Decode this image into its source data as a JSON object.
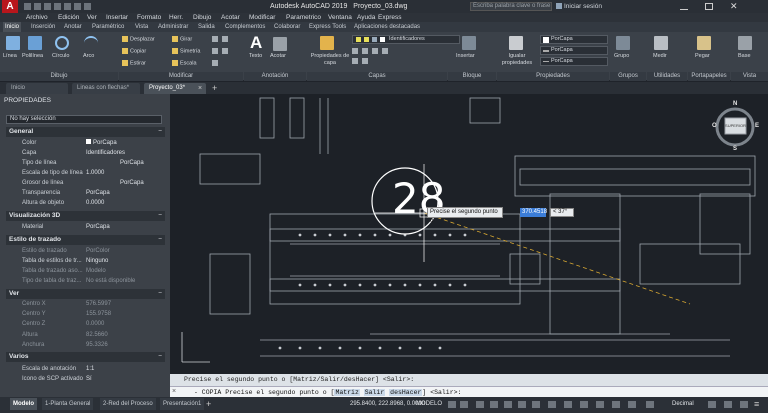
{
  "title_bar": {
    "app_title": "Autodesk AutoCAD 2019",
    "document": "Proyecto_03.dwg",
    "search_placeholder": "Escriba palabra clave o frase",
    "signin": "Iniciar sesión"
  },
  "menu": [
    "Archivo",
    "Edición",
    "Ver",
    "Insertar",
    "Formato",
    "Herr.",
    "Dibujo",
    "Acotar",
    "Modificar",
    "Parametrico",
    "Ventana",
    "Ayuda",
    "Express"
  ],
  "ribbon_tabs": [
    "Inicio",
    "Inserción",
    "Anotar",
    "Paramétrico",
    "Vista",
    "Administrar",
    "Salida",
    "Complementos",
    "Colaborar",
    "Express Tools",
    "Aplicaciones destacadas"
  ],
  "ribbon": {
    "draw": {
      "tools": [
        "Línea",
        "Polilínea",
        "Círculo",
        "Arco"
      ],
      "panel": "Dibujo"
    },
    "modify": {
      "tools": [
        "Desplazar",
        "Girar",
        "Copiar",
        "Simetría",
        "Estirar",
        "Escala"
      ],
      "panel": "Modificar"
    },
    "annotation": {
      "tools": [
        "Texto",
        "Acotar"
      ],
      "panel": "Anotación"
    },
    "layers": {
      "props_button": "Propiedades de capa",
      "layer_name": "Identificadores",
      "panel": "Capas"
    },
    "block": {
      "insert": "Insertar",
      "panel": "Bloque"
    },
    "properties": {
      "match": "Igualar propiedades",
      "bylayer": "PorCapa",
      "panel": "Propiedades"
    },
    "groups": {
      "group": "Grupo",
      "panel": "Grupos"
    },
    "utilities": {
      "measure": "Medir",
      "panel": "Utilidades"
    },
    "clipboard": {
      "paste": "Pegar",
      "panel": "Portapapeles"
    },
    "view": {
      "base": "Base",
      "panel": "Vista"
    }
  },
  "file_tabs": [
    "Inicio",
    "Lineas con flechas*",
    "Proyecto_03*"
  ],
  "properties": {
    "title": "PROPIEDADES",
    "selection": "No hay selección",
    "sections": {
      "general": "General",
      "visual3d": "Visualización 3D",
      "plotstyle": "Estilo de trazado",
      "view": "Ver",
      "misc": "Varios"
    },
    "general_rows": [
      {
        "k": "Color",
        "v": "PorCapa"
      },
      {
        "k": "Capa",
        "v": "Identificadores"
      },
      {
        "k": "Tipo de línea",
        "v": "PorCapa"
      },
      {
        "k": "Escala de tipo de línea",
        "v": "1.0000"
      },
      {
        "k": "Grosor de línea",
        "v": "PorCapa"
      },
      {
        "k": "Transparencia",
        "v": "PorCapa"
      },
      {
        "k": "Altura de objeto",
        "v": "0.0000"
      }
    ],
    "visual3d_rows": [
      {
        "k": "Material",
        "v": "PorCapa"
      }
    ],
    "plotstyle_rows": [
      {
        "k": "Estilo de trazado",
        "v": "PorColor"
      },
      {
        "k": "Tabla de estilos de tr...",
        "v": "Ninguno"
      },
      {
        "k": "Tabla de trazado aso...",
        "v": "Modelo"
      },
      {
        "k": "Tipo de tabla de traz...",
        "v": "No está disponible"
      }
    ],
    "view_rows": [
      {
        "k": "Centro X",
        "v": "576.5997"
      },
      {
        "k": "Centro Y",
        "v": "155.9758"
      },
      {
        "k": "Centro Z",
        "v": "0.0000"
      },
      {
        "k": "Altura",
        "v": "82.5660"
      },
      {
        "k": "Anchura",
        "v": "95.3326"
      }
    ],
    "misc_rows": [
      {
        "k": "Escala de anotación",
        "v": "1:1"
      },
      {
        "k": "Icono de SCP activado",
        "v": "Sí"
      }
    ]
  },
  "canvas": {
    "number_label": "28",
    "dynamic_prompt": "Precise el segundo punto o",
    "distance_value": "370.4518",
    "angle_value": "< 37°",
    "viewcube_face": "SUPERIOR",
    "compass": [
      "N",
      "S",
      "O",
      "E"
    ]
  },
  "command": {
    "history": "Precise el segundo punto o [Matriz/Salir/desHacer] <Salir>:",
    "prefix": "- COPIA Precise el segundo punto o [",
    "options": [
      "Matriz",
      "Salir",
      "desHacer"
    ],
    "suffix": "] <Salir>:"
  },
  "status": {
    "layout_tabs": [
      "Modelo",
      "1-Planta General",
      "2-Red del Proceso",
      "Presentación1"
    ],
    "coords": "295.8400, 222.8968, 0.0000",
    "space": "MODELO",
    "units": "Decimal"
  }
}
